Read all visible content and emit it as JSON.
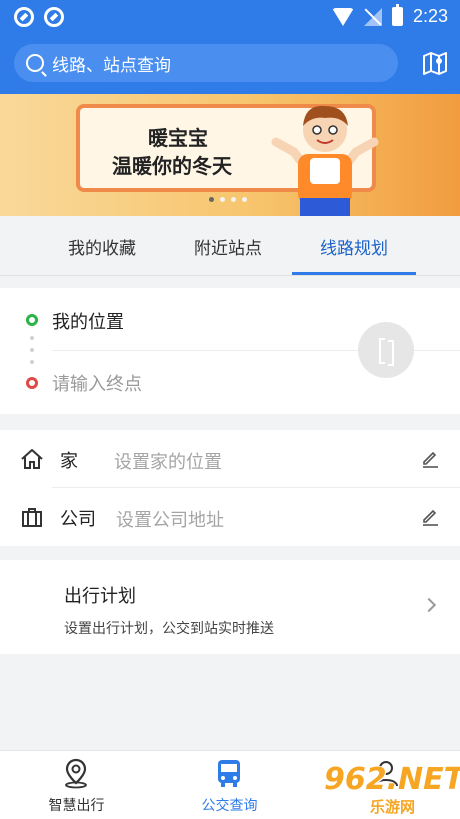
{
  "status_bar": {
    "time": "2:23"
  },
  "search": {
    "placeholder": "线路、站点查询"
  },
  "banner": {
    "line1": "暖宝宝",
    "line2": "温暖你的冬天",
    "active_dot": 1,
    "dot_count": 4
  },
  "tabs": [
    {
      "label": "我的收藏",
      "active": false
    },
    {
      "label": "附近站点",
      "active": false
    },
    {
      "label": "线路规划",
      "active": true
    }
  ],
  "route": {
    "start_label": "我的位置",
    "destination_placeholder": "请输入终点"
  },
  "places": {
    "home": {
      "name": "家",
      "hint": "设置家的位置"
    },
    "company": {
      "name": "公司",
      "hint": "设置公司地址"
    }
  },
  "plan": {
    "title": "出行计划",
    "subtitle": "设置出行计划，公交到站实时推送"
  },
  "bottom_nav": [
    {
      "label": "智慧出行",
      "icon": "location-pin-icon",
      "active": false
    },
    {
      "label": "公交查询",
      "icon": "bus-icon",
      "active": true
    },
    {
      "label": "",
      "icon": "profile-icon",
      "active": false
    }
  ],
  "watermark": {
    "big": "962.NET",
    "small": "乐游网"
  },
  "colors": {
    "primary": "#2f7be8",
    "start_point": "#2cb34a",
    "end_point": "#e04848",
    "banner_orange": "#f29c3f"
  }
}
